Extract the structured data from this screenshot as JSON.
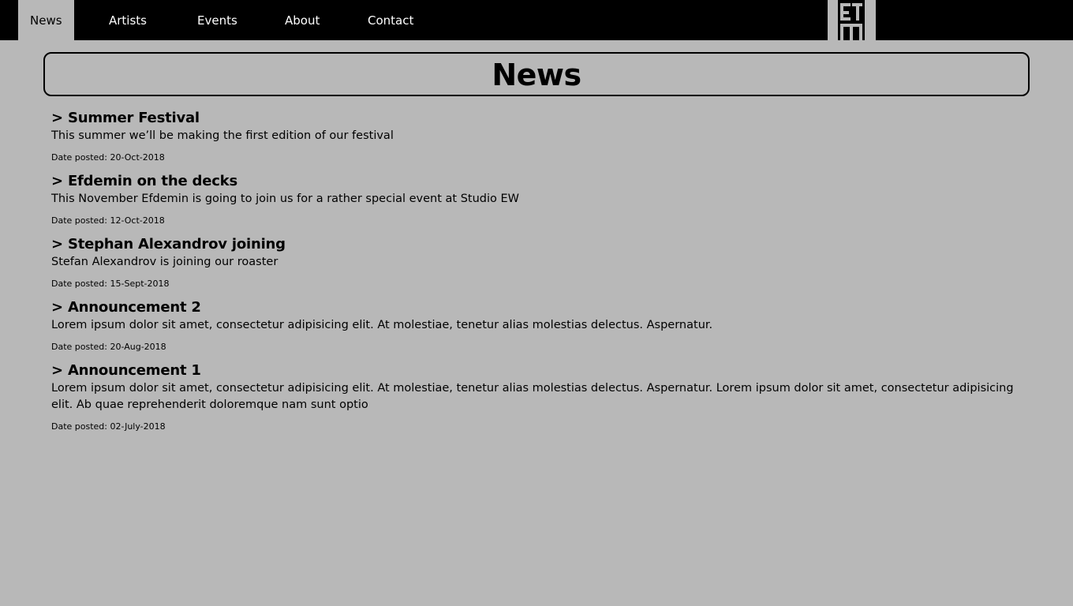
{
  "nav": {
    "items": [
      {
        "label": "News",
        "active": true
      },
      {
        "label": "Artists",
        "active": false
      },
      {
        "label": "Events",
        "active": false
      },
      {
        "label": "About",
        "active": false
      },
      {
        "label": "Contact",
        "active": false
      }
    ],
    "logo_icon": "studio-ew-logo-icon"
  },
  "page": {
    "title": "News"
  },
  "news": [
    {
      "title": "> Summer Festival",
      "body": "This summer we’ll be making the first edition of our festival",
      "date": "Date posted: 20-Oct-2018"
    },
    {
      "title": "> Efdemin on the decks",
      "body": "This November Efdemin is going to join us for a rather special event at Studio EW",
      "date": "Date posted: 12-Oct-2018"
    },
    {
      "title": "> Stephan Alexandrov joining",
      "body": "Stefan Alexandrov is joining our roaster",
      "date": "Date posted: 15-Sept-2018"
    },
    {
      "title": "> Announcement 2",
      "body": "Lorem ipsum dolor sit amet, consectetur adipisicing elit. At molestiae, tenetur alias molestias delectus. Aspernatur.",
      "date": "Date posted: 20-Aug-2018"
    },
    {
      "title": "> Announcement 1",
      "body": "Lorem ipsum dolor sit amet, consectetur adipisicing elit. At molestiae, tenetur alias molestias delectus. Aspernatur. Lorem ipsum dolor sit amet, consectetur adipisicing elit. Ab quae reprehenderit doloremque nam sunt optio",
      "date": "Date posted: 02-July-2018"
    }
  ],
  "colors": {
    "background": "#b8b8b8",
    "nav_background": "#000000",
    "text": "#000000",
    "nav_text": "#ffffff"
  }
}
